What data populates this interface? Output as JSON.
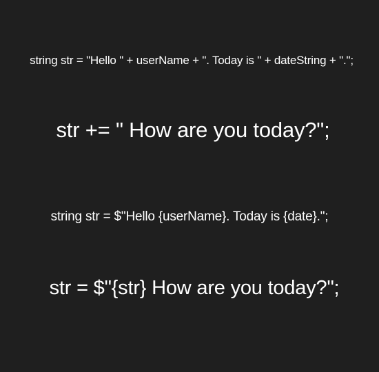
{
  "lines": [
    "string str = \"Hello \" + userName + \". Today is \" + dateString + \".\";",
    "str += \" How are you today?\";",
    "string str = $\"Hello {userName}. Today is {date}.\";",
    "str = $\"{str} How are you today?\";"
  ]
}
